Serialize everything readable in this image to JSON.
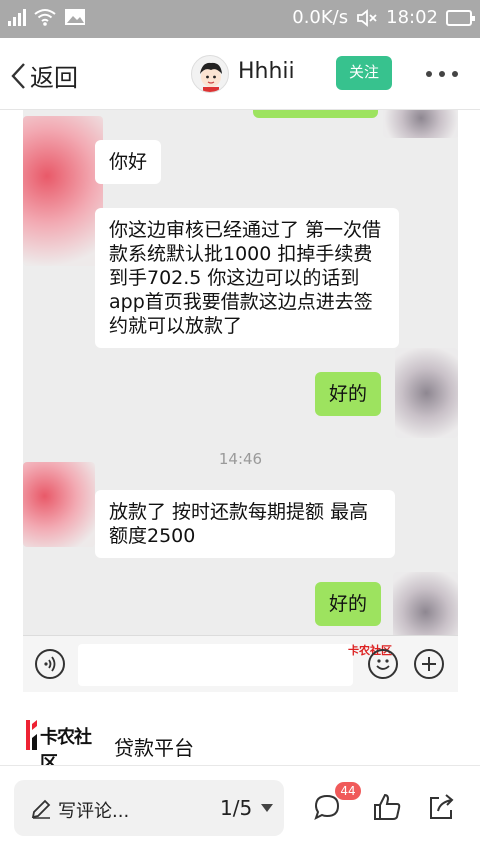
{
  "status_bar": {
    "speed": "0.0K/s",
    "time": "18:02"
  },
  "nav": {
    "back_label": "返回",
    "username": "Hhhii",
    "follow_label": "关注"
  },
  "chat": {
    "messages": [
      {
        "side": "left",
        "text": "你好"
      },
      {
        "side": "left",
        "text": "你这边审核已经通过了 第一次借款系统默认批1000 扣掉手续费到手702.5 你这边可以的话到app首页我要借款这边点进去签约就可以放款了"
      },
      {
        "side": "right",
        "text": "好的"
      },
      {
        "side": "left",
        "text": "放款了 按时还款每期提额 最高额度2500"
      },
      {
        "side": "right",
        "text": "好的"
      }
    ],
    "timestamp": "14:46",
    "watermark": "卡农社区"
  },
  "link": {
    "logo_text": "卡农社区",
    "title": "贷款平台"
  },
  "bottom_bar": {
    "comment_placeholder": "写评论...",
    "pager": "1/5",
    "comment_count": "44"
  },
  "colors": {
    "follow": "#37c28e",
    "green_bubble": "#9de35f",
    "badge": "#f05a5a"
  },
  "icons": [
    "signal-icon",
    "wifi-icon",
    "image-icon",
    "mute-icon",
    "battery-icon",
    "back-chevron-icon",
    "more-icon",
    "voice-icon",
    "emoji-icon",
    "plus-icon",
    "pen-icon",
    "comment-icon",
    "like-icon",
    "share-icon"
  ]
}
